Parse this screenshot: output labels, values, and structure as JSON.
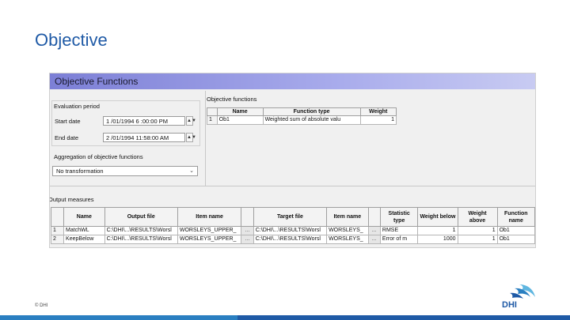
{
  "slide": {
    "title": "Objective",
    "footer": "© DHI"
  },
  "window": {
    "title": "Objective Functions"
  },
  "evaluation_period": {
    "label": "Evaluation period",
    "start_label": "Start date",
    "start_value": "1 /01/1994  6 :00:00 PM",
    "end_label": "End date",
    "end_value": "2 /01/1994 11:58:00 AM"
  },
  "aggregation": {
    "label": "Aggregation of objective functions",
    "selected": "No transformation"
  },
  "objective_functions": {
    "label": "Objective functions",
    "headers": [
      "Name",
      "Function type",
      "Weight"
    ],
    "rows": [
      {
        "idx": "1",
        "name": "Ob1",
        "type": "Weighted sum of absolute valu",
        "weight": "1"
      }
    ]
  },
  "output_measures": {
    "label": "Output measures",
    "headers": {
      "name": "Name",
      "output_file": "Output file",
      "item_name": "Item name",
      "target_file": "Target file",
      "target_item": "Item name",
      "statistic": "Statistic type",
      "weight_below": "Weight below",
      "weight_above": "Weight above",
      "function_name": "Function name"
    },
    "rows": [
      {
        "idx": "1",
        "name": "MatchWL",
        "output_file": "C:\\DHI\\...\\RESULTS\\Worsl",
        "item": "WORSLEYS_UPPER_",
        "browse": "...",
        "target_file": "C:\\DHI\\...\\RESULTS\\Worsl",
        "target_item": "WORSLEYS_",
        "browse2": "...",
        "statistic": "RMSE",
        "weight_below": "1",
        "weight_above": "1",
        "function": "Ob1"
      },
      {
        "idx": "2",
        "name": "KeepBelow",
        "output_file": "C:\\DHI\\...\\RESULTS\\Worsl",
        "item": "WORSLEYS_UPPER_",
        "browse": "...",
        "target_file": "C:\\DHI\\...\\RESULTS\\Worsl",
        "target_item": "WORSLEYS_",
        "browse2": "...",
        "statistic": "Error of m",
        "weight_below": "1000",
        "weight_above": "1",
        "function": "Ob1"
      }
    ]
  },
  "icons": {
    "spin": "spin-arrows-icon",
    "dropdown": "chevron-down-icon",
    "logo": "dhi-logo"
  },
  "colors": {
    "title": "#1f5aa6",
    "header_gradient_start": "#7c7fd6",
    "bottom_bar": "#1f5aa6"
  }
}
